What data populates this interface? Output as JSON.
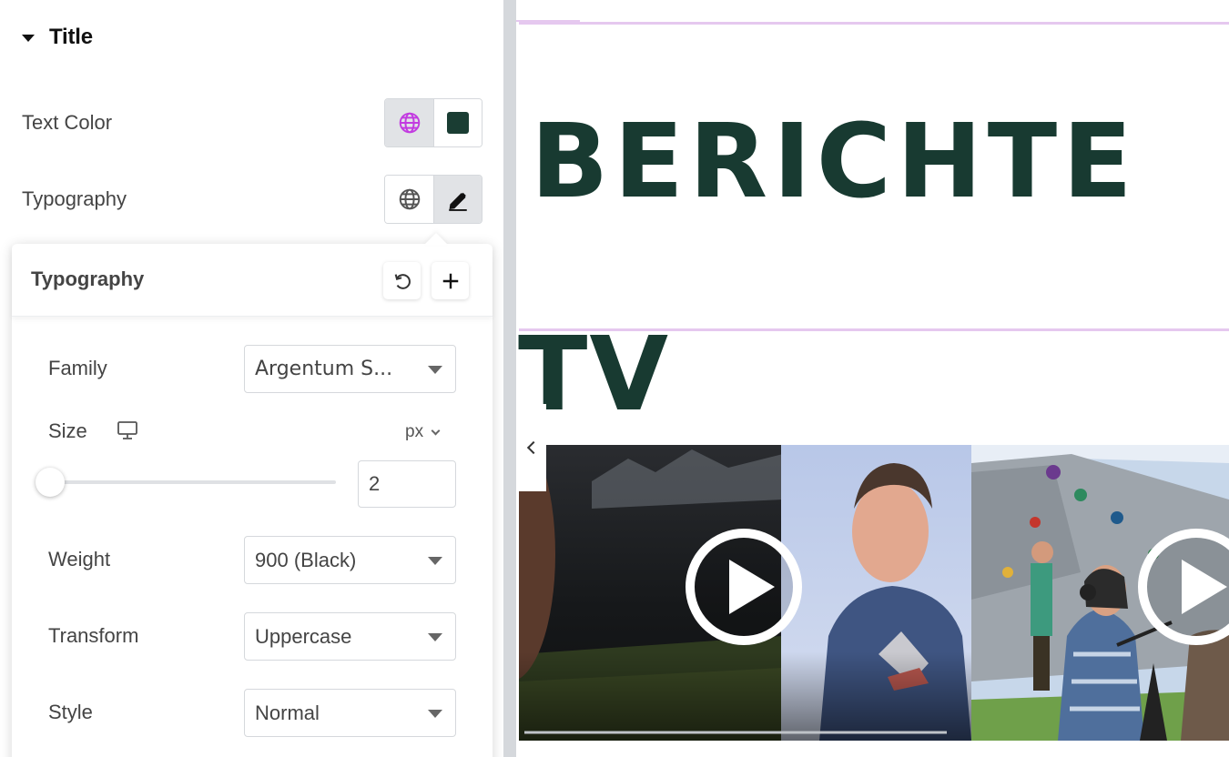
{
  "section": {
    "title": "Title"
  },
  "controls": {
    "text_color": {
      "label": "Text Color",
      "swatch_color": "#1a3d33"
    },
    "typography": {
      "label": "Typography"
    }
  },
  "popover": {
    "title": "Typography",
    "family": {
      "label": "Family",
      "value": "Argentum S..."
    },
    "size": {
      "label": "Size",
      "unit": "px",
      "value": "2"
    },
    "weight": {
      "label": "Weight",
      "value": "900 (Black)"
    },
    "transform": {
      "label": "Transform",
      "value": "Uppercase"
    },
    "style": {
      "label": "Style",
      "value": "Normal"
    }
  },
  "preview": {
    "heading": "BERICHTE",
    "subheading": "TV",
    "accent_line_color": "#e5c8ef",
    "title_color": "#183a31"
  },
  "icons": {
    "global": "globe-icon",
    "edit": "pencil-icon",
    "reset": "reset-icon",
    "add": "plus-icon",
    "device": "desktop-icon",
    "play": "play-icon",
    "collapse": "chevron-left-icon"
  }
}
